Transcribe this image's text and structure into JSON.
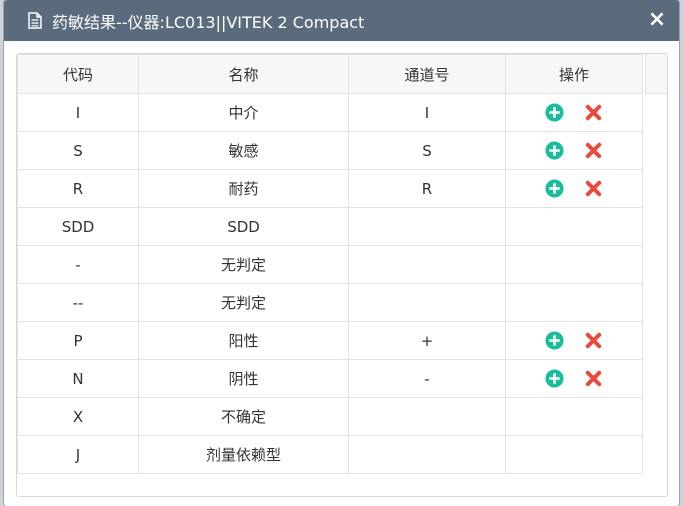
{
  "dialog": {
    "title": "药敏结果--仪器:LC013||VITEK 2 Compact",
    "close_label": "×"
  },
  "table": {
    "headers": [
      "代码",
      "名称",
      "通道号",
      "操作"
    ],
    "rows": [
      {
        "code": "I",
        "name": "中介",
        "channel": "I",
        "actions": true
      },
      {
        "code": "S",
        "name": "敏感",
        "channel": "S",
        "actions": true
      },
      {
        "code": "R",
        "name": "耐药",
        "channel": "R",
        "actions": true
      },
      {
        "code": "SDD",
        "name": "SDD",
        "channel": "",
        "actions": false
      },
      {
        "code": "-",
        "name": "无判定",
        "channel": "",
        "actions": false
      },
      {
        "code": "--",
        "name": "无判定",
        "channel": "",
        "actions": false
      },
      {
        "code": "P",
        "name": "阳性",
        "channel": "+",
        "actions": true
      },
      {
        "code": "N",
        "name": "阴性",
        "channel": "-",
        "actions": true
      },
      {
        "code": "X",
        "name": "不确定",
        "channel": "",
        "actions": false
      },
      {
        "code": "J",
        "name": "剂量依赖型",
        "channel": "",
        "actions": false
      }
    ]
  },
  "icons": {
    "add": "plus-circle-icon",
    "delete": "x-icon",
    "title": "document-icon"
  },
  "colors": {
    "titlebar": "#5b6b7e",
    "add": "#1abc9c",
    "delete": "#e74c3c"
  }
}
